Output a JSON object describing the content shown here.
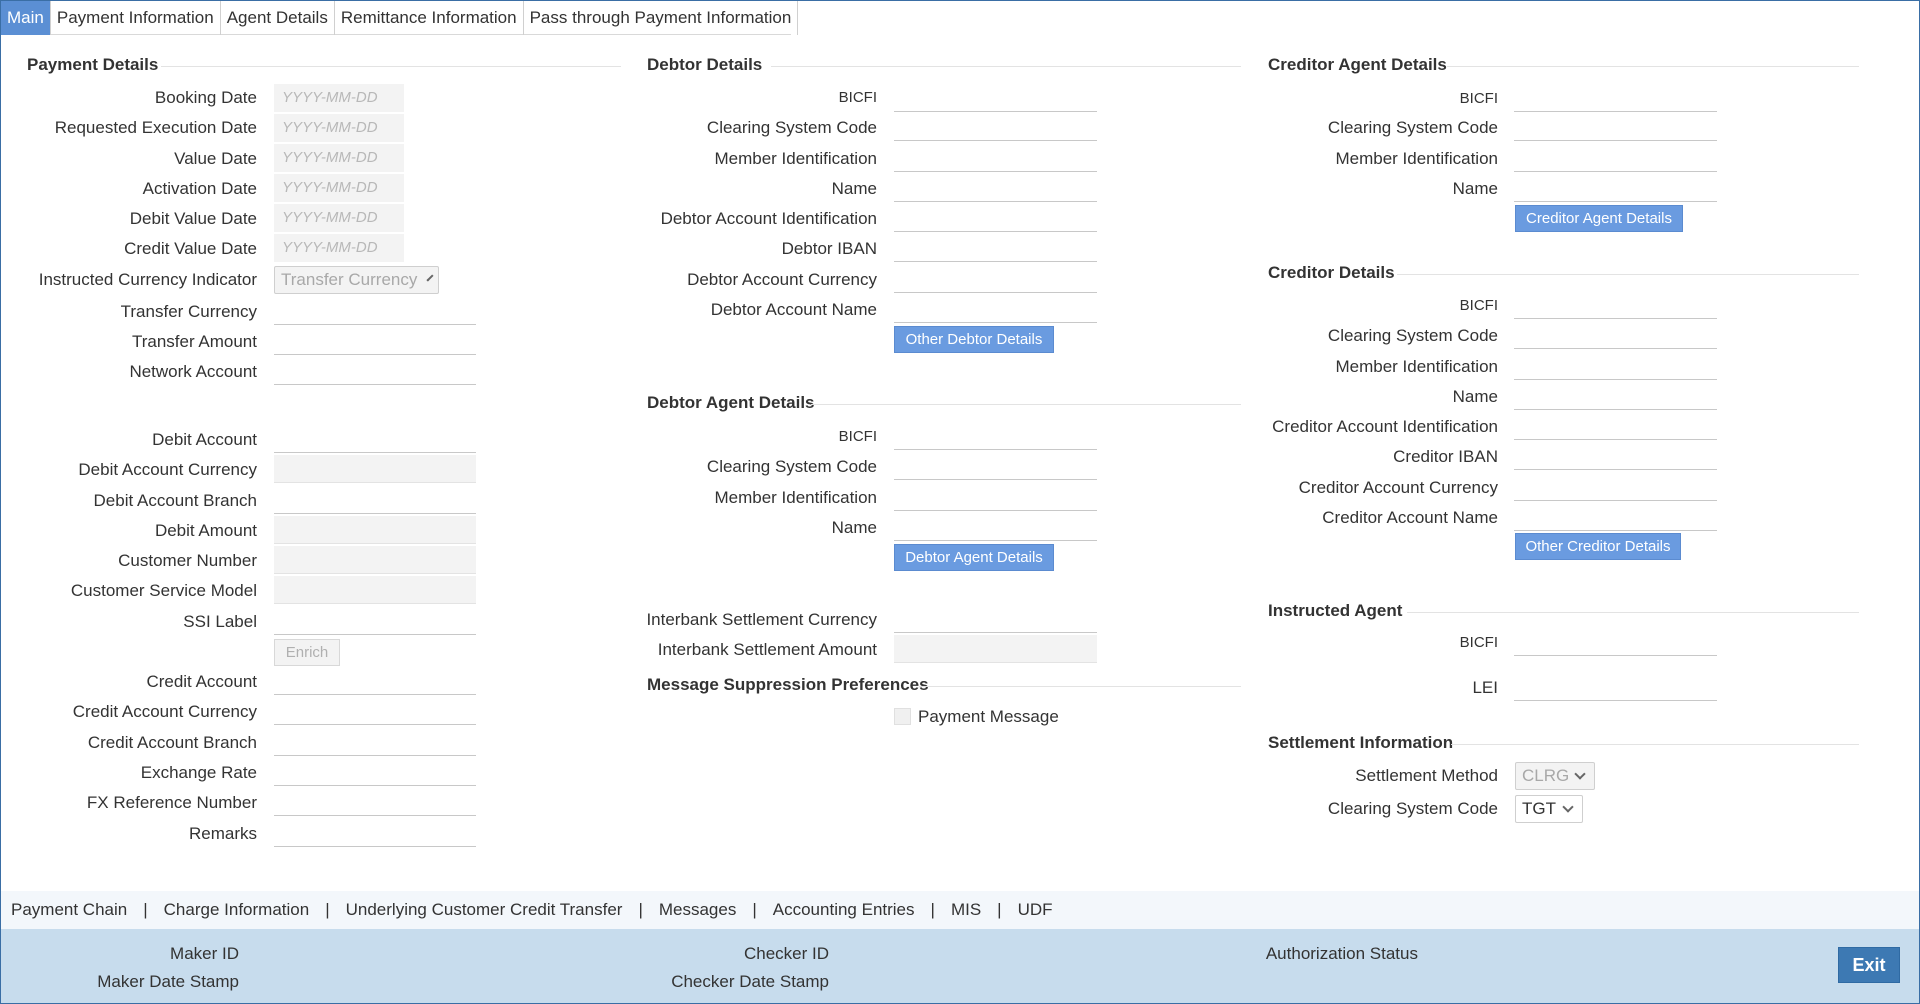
{
  "tabs": [
    "Main",
    "Payment Information",
    "Agent Details",
    "Remittance Information",
    "Pass through Payment Information"
  ],
  "payment_details": {
    "title": "Payment Details",
    "booking_date": {
      "label": "Booking Date",
      "placeholder": "YYYY-MM-DD"
    },
    "requested_execution_date": {
      "label": "Requested Execution Date",
      "placeholder": "YYYY-MM-DD"
    },
    "value_date": {
      "label": "Value Date",
      "placeholder": "YYYY-MM-DD"
    },
    "activation_date": {
      "label": "Activation Date",
      "placeholder": "YYYY-MM-DD"
    },
    "debit_value_date": {
      "label": "Debit Value Date",
      "placeholder": "YYYY-MM-DD"
    },
    "credit_value_date": {
      "label": "Credit Value Date",
      "placeholder": "YYYY-MM-DD"
    },
    "instructed_currency_indicator": {
      "label": "Instructed Currency Indicator",
      "value": "Transfer Currency"
    },
    "transfer_currency": {
      "label": "Transfer Currency",
      "value": ""
    },
    "transfer_amount": {
      "label": "Transfer Amount",
      "value": ""
    },
    "network_account": {
      "label": "Network Account",
      "value": ""
    },
    "debit_account": {
      "label": "Debit Account",
      "value": ""
    },
    "debit_account_currency": {
      "label": "Debit Account Currency",
      "value": ""
    },
    "debit_account_branch": {
      "label": "Debit Account Branch",
      "value": ""
    },
    "debit_amount": {
      "label": "Debit Amount",
      "value": ""
    },
    "customer_number": {
      "label": "Customer Number",
      "value": ""
    },
    "customer_service_model": {
      "label": "Customer Service Model",
      "value": ""
    },
    "ssi_label": {
      "label": "SSI Label",
      "value": ""
    },
    "enrich_button": "Enrich",
    "credit_account": {
      "label": "Credit Account",
      "value": ""
    },
    "credit_account_currency": {
      "label": "Credit Account Currency",
      "value": ""
    },
    "credit_account_branch": {
      "label": "Credit Account Branch",
      "value": ""
    },
    "exchange_rate": {
      "label": "Exchange Rate",
      "value": ""
    },
    "fx_reference_number": {
      "label": "FX Reference Number",
      "value": ""
    },
    "remarks": {
      "label": "Remarks",
      "value": ""
    }
  },
  "debtor_details": {
    "title": "Debtor Details",
    "bicfi": "BICFI",
    "clearing_system_code": "Clearing System Code",
    "member_identification": "Member Identification",
    "name": "Name",
    "debtor_account_identification": "Debtor Account Identification",
    "debtor_iban": "Debtor IBAN",
    "debtor_account_currency": "Debtor Account Currency",
    "debtor_account_name": "Debtor Account Name",
    "other_button": "Other Debtor Details"
  },
  "debtor_agent_details": {
    "title": "Debtor Agent Details",
    "bicfi": "BICFI",
    "clearing_system_code": "Clearing System Code",
    "member_identification": "Member Identification",
    "name": "Name",
    "button": "Debtor Agent Details",
    "interbank_settlement_currency": "Interbank Settlement Currency",
    "interbank_settlement_amount": "Interbank Settlement Amount"
  },
  "message_suppression": {
    "title": "Message Suppression Preferences",
    "payment_message": "Payment Message"
  },
  "creditor_agent_details": {
    "title": "Creditor Agent Details",
    "bicfi": "BICFI",
    "clearing_system_code": "Clearing System Code",
    "member_identification": "Member Identification",
    "name": "Name",
    "button": "Creditor Agent Details"
  },
  "creditor_details": {
    "title": "Creditor Details",
    "bicfi": "BICFI",
    "clearing_system_code": "Clearing System Code",
    "member_identification": "Member Identification",
    "name": "Name",
    "creditor_account_identification": "Creditor Account Identification",
    "creditor_iban": "Creditor IBAN",
    "creditor_account_currency": "Creditor Account Currency",
    "creditor_account_name": "Creditor Account Name",
    "other_button": "Other Creditor Details"
  },
  "instructed_agent": {
    "title": "Instructed Agent",
    "bicfi": "BICFI",
    "lei": "LEI"
  },
  "settlement_information": {
    "title": "Settlement Information",
    "settlement_method": {
      "label": "Settlement Method",
      "value": "CLRG"
    },
    "clearing_system_code": {
      "label": "Clearing System Code",
      "value": "TGT"
    }
  },
  "footer_links": [
    "Payment Chain",
    "Charge Information",
    "Underlying Customer Credit Transfer",
    "Messages",
    "Accounting Entries",
    "MIS",
    "UDF"
  ],
  "footer_separator": "|",
  "audit": {
    "maker_id": "Maker ID",
    "maker_date_stamp": "Maker Date Stamp",
    "checker_id": "Checker ID",
    "checker_date_stamp": "Checker Date Stamp",
    "authorization_status": "Authorization Status",
    "exit_button": "Exit"
  },
  "colors": {
    "tab_active": "#5b8fd4",
    "button": "#6a9be0",
    "audit_bg": "#c7dced",
    "exit_bg": "#3d79b3"
  }
}
